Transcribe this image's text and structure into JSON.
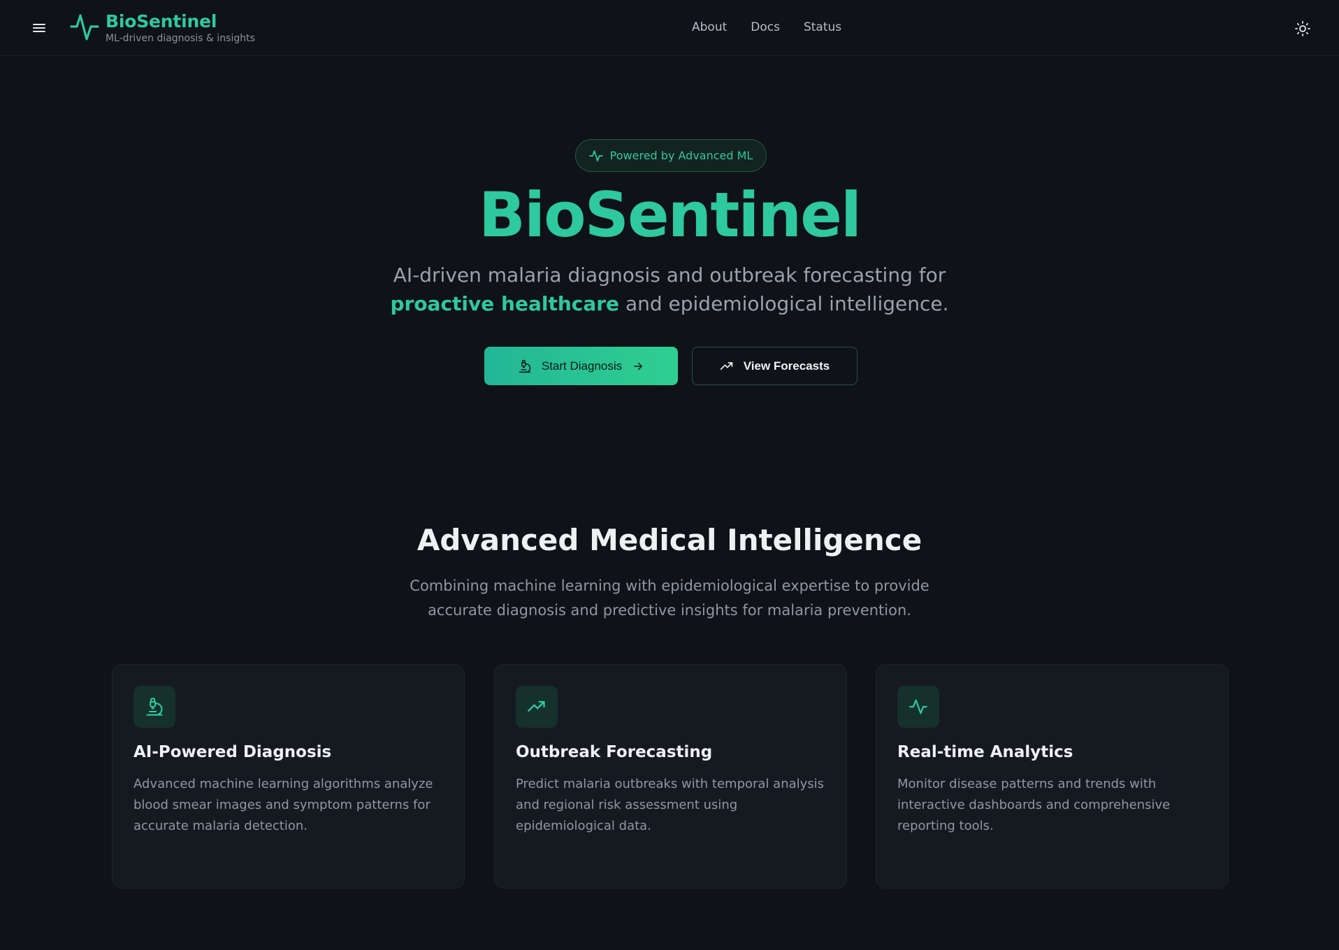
{
  "header": {
    "brand_name": "BioSentinel",
    "brand_tagline": "ML-driven diagnosis & insights",
    "menu_icon": "hamburger-menu-icon",
    "logo_icon": "activity-pulse-icon",
    "theme_icon": "sun-icon",
    "nav": [
      {
        "label": "About"
      },
      {
        "label": "Docs"
      },
      {
        "label": "Status"
      }
    ]
  },
  "hero": {
    "badge_label": "Powered by Advanced ML",
    "badge_icon": "activity-pulse-icon",
    "title": "BioSentinel",
    "subtitle_part1": "AI-driven malaria diagnosis and outbreak forecasting for ",
    "subtitle_highlight": "proactive healthcare",
    "subtitle_part2": " and epidemiological intelligence.",
    "primary_button": {
      "label": "Start Diagnosis",
      "icon": "microscope-icon",
      "trailing_icon": "arrow-right-icon"
    },
    "secondary_button": {
      "label": "View Forecasts",
      "icon": "trending-up-icon"
    }
  },
  "features": {
    "title": "Advanced Medical Intelligence",
    "subtitle": "Combining machine learning with epidemiological expertise to provide accurate diagnosis and predictive insights for malaria prevention.",
    "cards": [
      {
        "title": "AI-Powered Diagnosis",
        "description": "Advanced machine learning algorithms analyze blood smear images and symptom patterns for accurate malaria detection.",
        "icon": "microscope-icon"
      },
      {
        "title": "Outbreak Forecasting",
        "description": "Predict malaria outbreaks with temporal analysis and regional risk assessment using epidemiological data.",
        "icon": "trending-up-icon"
      },
      {
        "title": "Real-time Analytics",
        "description": "Monitor disease patterns and trends with interactive dashboards and comprehensive reporting tools.",
        "icon": "activity-pulse-icon"
      }
    ]
  },
  "colors": {
    "background": "#0f1217",
    "accent": "#2ec99e",
    "card_background": "#151a21",
    "muted_text": "#8f97a2"
  }
}
